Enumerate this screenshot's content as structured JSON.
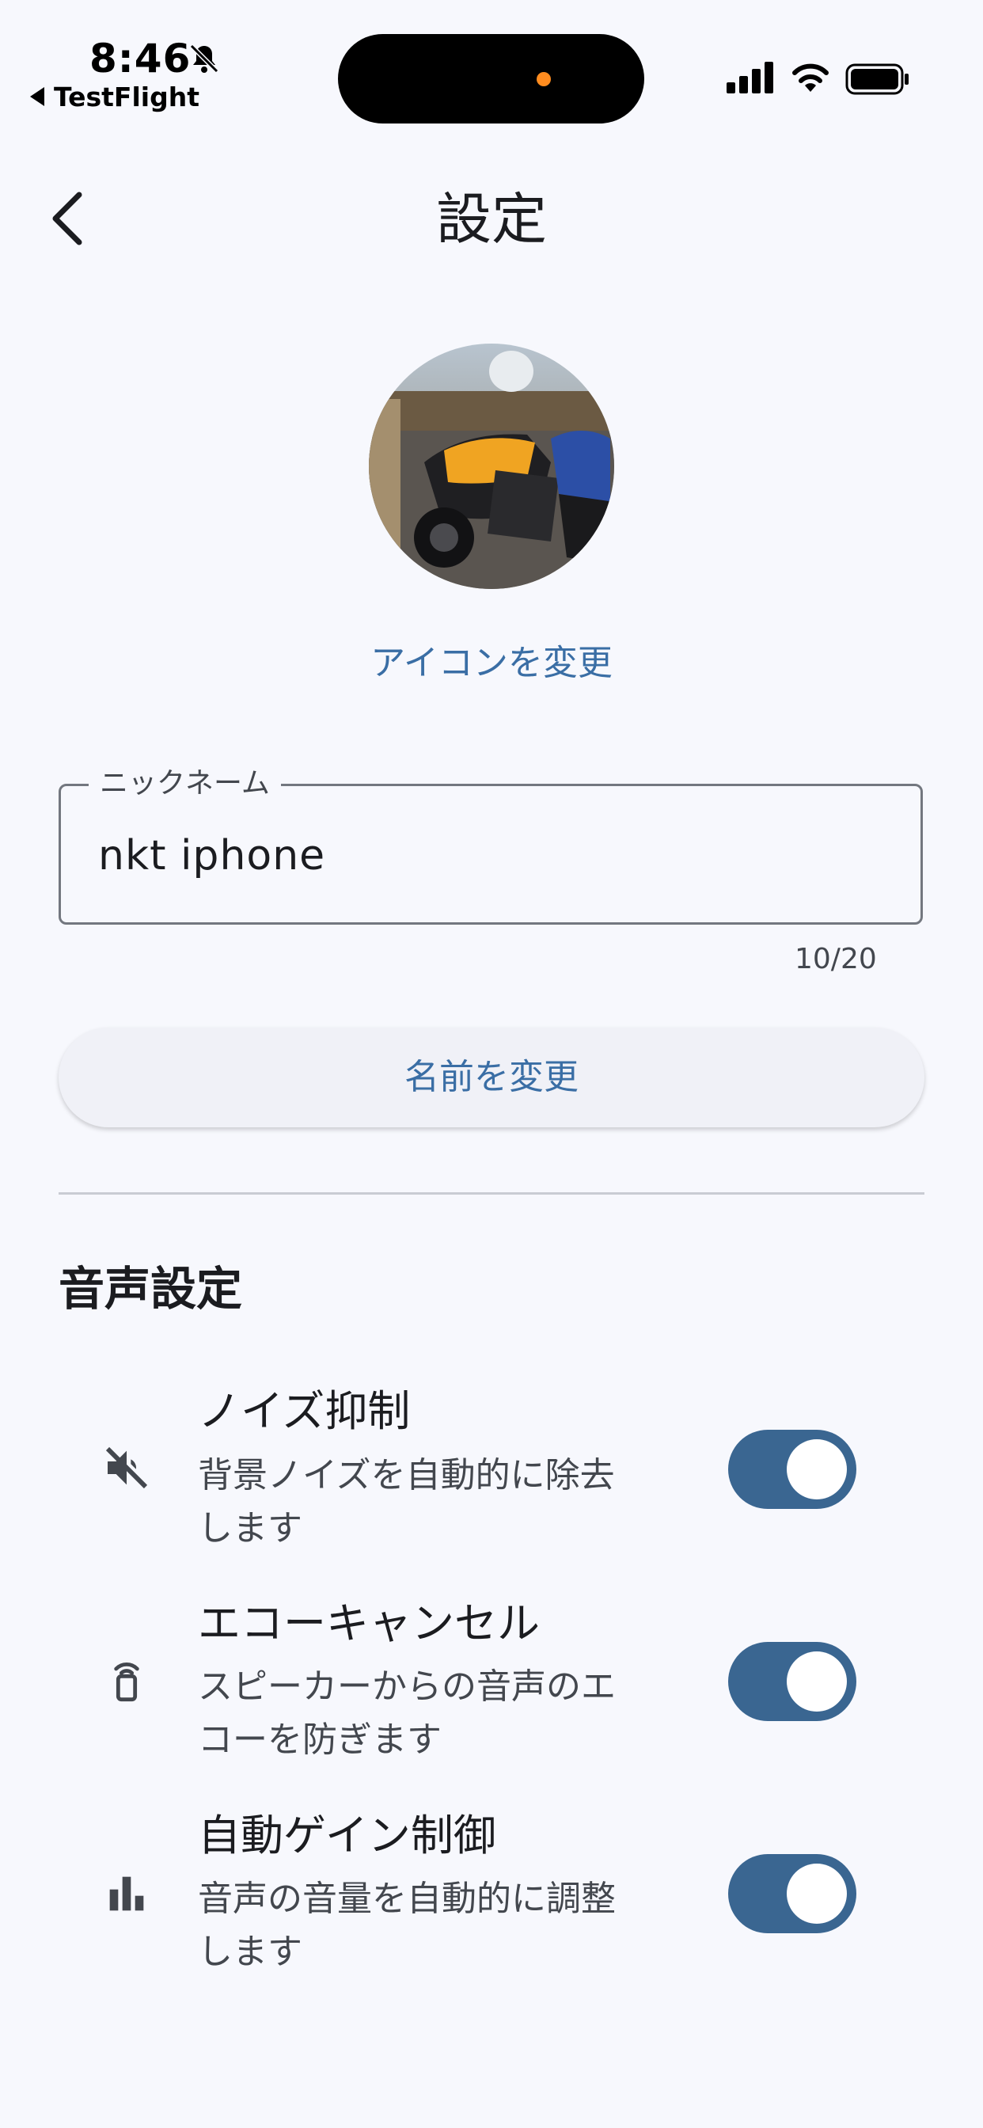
{
  "status_bar": {
    "time": "8:46",
    "back_app": "TestFlight",
    "icons": [
      "bell-slash-icon",
      "cellular-signal-icon",
      "wifi-icon",
      "battery-icon"
    ]
  },
  "app_bar": {
    "title": "設定",
    "back_icon": "chevron-left-icon"
  },
  "profile": {
    "avatar": "motorcycle-photo",
    "change_icon_label": "アイコンを変更"
  },
  "nickname": {
    "label": "ニックネーム",
    "value": "nkt iphone",
    "counter": "10/20"
  },
  "rename_button": "名前を変更",
  "audio_section": {
    "title": "音声設定",
    "items": [
      {
        "icon": "volume-off-icon",
        "title": "ノイズ抑制",
        "subtitle_line1": "背景ノイズを自動的に除去",
        "subtitle_line2": "します",
        "enabled": true
      },
      {
        "icon": "speaker-phone-icon",
        "title": "エコーキャンセル",
        "subtitle_line1": "スピーカーからの音声のエ",
        "subtitle_line2": "コーを防ぎます",
        "enabled": true
      },
      {
        "icon": "bar-chart-icon",
        "title": "自動ゲイン制御",
        "subtitle_line1": "音声の音量を自動的に調整",
        "subtitle_line2": "します",
        "enabled": true
      }
    ]
  },
  "colors": {
    "background": "#f7f8fd",
    "accent": "#3a6ea5",
    "switch_on": "#3a6691"
  }
}
